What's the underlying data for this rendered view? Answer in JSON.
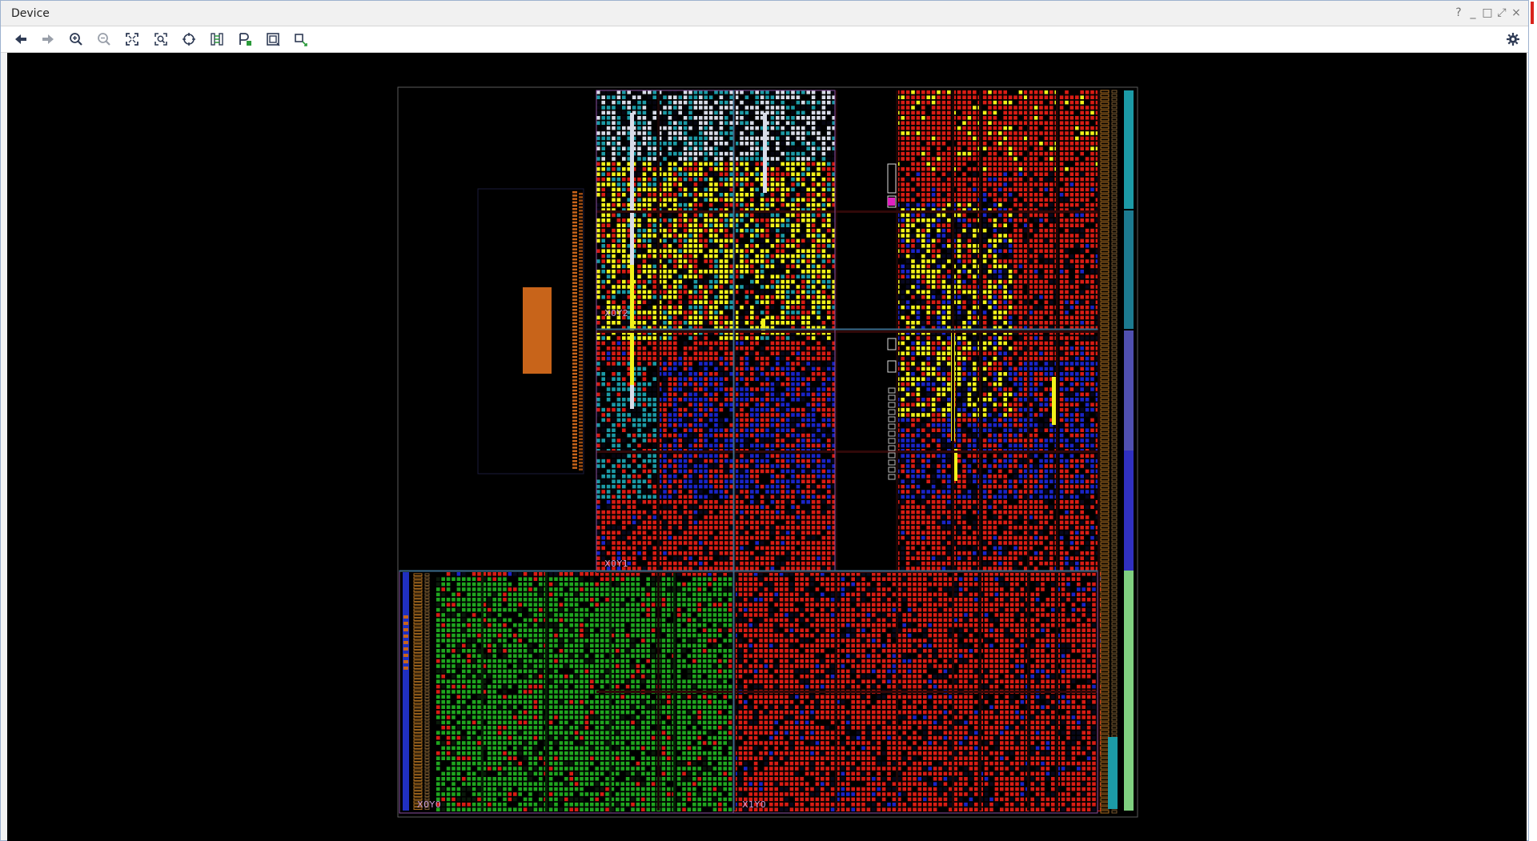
{
  "window": {
    "title": "Device",
    "controls": [
      "?",
      "_",
      "□",
      "⤢",
      "×"
    ]
  },
  "toolbar": {
    "buttons": [
      {
        "name": "back-button",
        "icon": "arrow-left-icon"
      },
      {
        "name": "forward-button",
        "icon": "arrow-right-icon"
      },
      {
        "name": "zoom-in-button",
        "icon": "zoom-in-icon"
      },
      {
        "name": "zoom-out-button",
        "icon": "zoom-out-icon"
      },
      {
        "name": "zoom-fit-button",
        "icon": "fit-icon"
      },
      {
        "name": "zoom-selection-button",
        "icon": "zoom-area-icon"
      },
      {
        "name": "autofit-selection-button",
        "icon": "target-icon"
      },
      {
        "name": "routing-resources-button",
        "icon": "routing-icon"
      },
      {
        "name": "pblock-button",
        "icon": "pblock-icon"
      },
      {
        "name": "show-cell-connections-button",
        "icon": "cell-connections-icon"
      },
      {
        "name": "show-io-connections-button",
        "icon": "io-connections-icon"
      }
    ],
    "settings_icon": "gear-icon"
  },
  "device_view": {
    "region_labels": [
      "X0Y2",
      "X0Y1",
      "X0Y0",
      "X1Y0"
    ],
    "colors": {
      "background": "#000000",
      "placed_red": "#d91c14",
      "placed_yellow": "#f2f21a",
      "placed_blue": "#1a24c8",
      "placed_green": "#1fa51f",
      "placed_cyan": "#1c9aa6",
      "placed_white": "#d8dce8",
      "io_orange": "#c8641a",
      "clock_region_border": "#8a4fa0"
    }
  }
}
